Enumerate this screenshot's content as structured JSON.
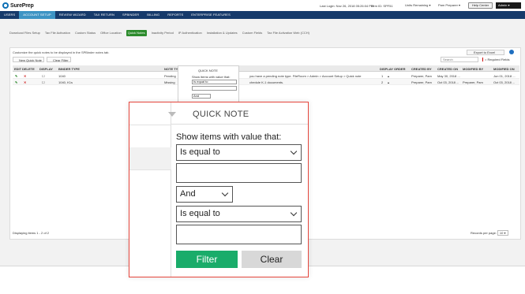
{
  "header": {
    "logo_text": "SurePrep",
    "last_login": "Last Login:  Nov 26, 2018 05:26:04 PM",
    "firm_id": "Firm ID:  SPF51",
    "units_remaining": "Units Remaining",
    "role": "Pam Preparer",
    "help_center": "Help Center",
    "admin": "Admin"
  },
  "nav": {
    "items": [
      "USERS",
      "ACCOUNT SETUP",
      "REVIEW WIZARD",
      "TAX RETURN",
      "SPBINDER",
      "BILLING",
      "REPORTS",
      "ENTERPRISE FEATURES"
    ],
    "active_index": 1
  },
  "subtabs": {
    "items": [
      "Download Files Setup",
      "Tax File Activation",
      "Custom Status",
      "Office Location",
      "Quick Notes",
      "Inactivity Period",
      "IP Authentication",
      "Installation & Updates",
      "Custom Fields",
      "Tax File Activation Web (CCH)"
    ],
    "active_index": 4
  },
  "panel": {
    "description": "Customize the quick notes to be displayed in the SPBinder notes tab.",
    "export": "Export to Excel",
    "new_quick_note": "New Quick Note",
    "clear_filter": "Clear Filter",
    "search_placeholder": "Search",
    "required_fields": "= Required Fields",
    "columns": [
      "EDIT",
      "DELETE",
      "DISPLAY",
      "BINDER TYPE",
      "NOTE TYPE",
      "",
      "DISPLAY ORDER",
      "CREATED BY",
      "CREATED ON",
      "MODIFIED BY",
      "MODIFIED ON"
    ],
    "rows": [
      {
        "binder_type": "1040",
        "note_type": "Pending",
        "note_text": "you have a pending note type. FileRoom > Admin > Account Setup > Quick note",
        "order": "1",
        "created_by": "Preparer, Pam",
        "created_on": "May 30, 2018 ...",
        "modified_by": "",
        "modified_on": "Jun 01, 2018 ..."
      },
      {
        "binder_type": "1040, K1s",
        "note_type": "Missing",
        "note_text": "chedule K-1 documents.",
        "order": "2",
        "created_by": "Preparer, Pam",
        "created_on": "Oct 03, 2018 ...",
        "modified_by": "Preparer, Pam",
        "modified_on": "Oct 03, 2018 ..."
      }
    ],
    "footer": "Displaying items 1 - 2 of 2",
    "records_per_page": "Records per page:",
    "records_value": "10"
  },
  "mini_popup": {
    "title": "QUICK NOTE",
    "label": "Show items with value that:",
    "op1": "Is equal to",
    "logic": "And"
  },
  "zoom_popup": {
    "title": "QUICK NOTE",
    "label": "Show items with value that:",
    "operator1": "Is equal to",
    "logic": "And",
    "operator2": "Is equal to",
    "filter_button": "Filter",
    "clear_button": "Clear"
  },
  "colors": {
    "nav_bg": "#163a6b",
    "nav_active": "#3d94c4",
    "subtab_active": "#2c8b2c",
    "filter_button": "#1aac6a",
    "clear_button": "#d8d8d8",
    "zoom_border": "#e6463d"
  }
}
